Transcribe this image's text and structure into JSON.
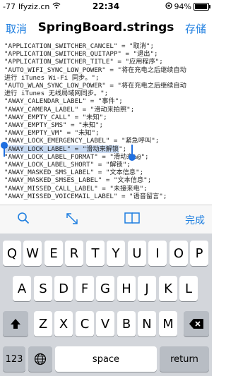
{
  "status": {
    "signal": "-77",
    "carrier": "lfyziz.cn",
    "time": "22:34",
    "battery": "94%",
    "battery_level": 0.94
  },
  "nav": {
    "cancel": "取消",
    "title": "SpringBoard.strings",
    "save": "存储"
  },
  "editor": {
    "lines": [
      "\"APPLICATION_SWITCHER_CANCEL\" = \"取消\";",
      "\"APPLICATION_SWITCHER_QUITAPP\" = \"退出\";",
      "\"APPLICATION_SWITCHER_TITLE\" = \"应用程序\";",
      "\"AUTO_WIFI_SYNC_LOW_POWER\" = \"将在充电之后继续自动",
      "进行 iTunes Wi-Fi 同步。\";",
      "\"AUTO_WLAN_SYNC_LOW_POWER\" = \"将在充电之后继续自动",
      "进行 iTunes 无线局域网同步。\";",
      "\"AWAY_CALENDAR_LABEL\" = \"事件\";",
      "\"AWAY_CAMERA_LABEL\" = \"滑动来拍照\";",
      "\"AWAY_EMPTY_CALL\" = \"未知\";",
      "\"AWAY_EMPTY_SMS\" = \"未知\";",
      "\"AWAY_EMPTY_VM\" = \"未知\";",
      "\"AWAY_LOCK_EMERGENCY_LABEL\" = \"紧急呼叫\";",
      "\"AWAY_LOCK_LABEL\" = \"滑动来解锁\";",
      "\"AWAY_LOCK_LABEL_FORMAT\" = \"滑动来%@\";",
      "\"AWAY_LOCK_LABEL_SHORT\" = \"解锁\";",
      "\"AWAY_MASKED_SMS_LABEL\" = \"文本信息\";",
      "\"AWAY_MASKED_SMSES_LABEL\" = \"文本信息\";",
      "\"AWAY_MISSED_CALL_LABEL\" = \"未接来电\";",
      "\"AWAY_MISSED_VOICEMAIL_LABEL\" = \"语音留言\";"
    ],
    "selected_text": "\"AWAY_LOCK_LABEL\" = \"滑动来解锁"
  },
  "toolbar": {
    "search_icon": "search-icon",
    "expand_icon": "expand-arrows-icon",
    "book_icon": "book-icon",
    "done": "完成"
  },
  "keyboard": {
    "row1": [
      "Q",
      "W",
      "E",
      "R",
      "T",
      "Y",
      "U",
      "I",
      "O",
      "P"
    ],
    "row2": [
      "A",
      "S",
      "D",
      "F",
      "G",
      "H",
      "J",
      "K",
      "L"
    ],
    "row3": [
      "Z",
      "X",
      "C",
      "V",
      "B",
      "N",
      "M"
    ],
    "numbers": "123",
    "space": "space",
    "return": "return"
  }
}
